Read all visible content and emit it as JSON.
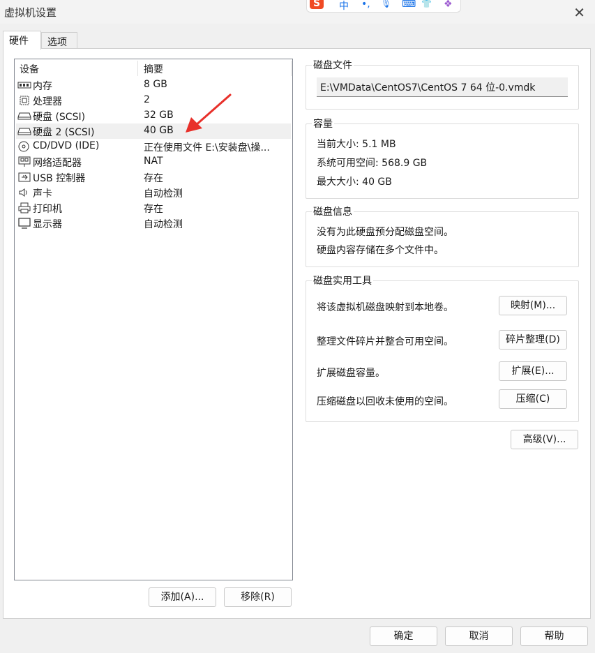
{
  "window": {
    "title": "虚拟机设置",
    "close_glyph": "✕"
  },
  "ime": {
    "logo": "S",
    "lang": "中",
    "punct": "•,",
    "mic": "🎙",
    "keyboard": "⌨",
    "shirt": "👕",
    "apps": "❖"
  },
  "tabs": [
    {
      "label": "硬件",
      "active": true
    },
    {
      "label": "选项",
      "active": false
    }
  ],
  "device_list": {
    "headers": {
      "device": "设备",
      "summary": "摘要"
    },
    "rows": [
      {
        "icon": "memory-icon",
        "name": "内存",
        "summary": "8 GB",
        "selected": false
      },
      {
        "icon": "processor-icon",
        "name": "处理器",
        "summary": "2",
        "selected": false
      },
      {
        "icon": "harddisk-icon",
        "name": "硬盘 (SCSI)",
        "summary": "32 GB",
        "selected": false
      },
      {
        "icon": "harddisk-icon",
        "name": "硬盘 2 (SCSI)",
        "summary": "40 GB",
        "selected": true
      },
      {
        "icon": "cd-dvd-icon",
        "name": "CD/DVD (IDE)",
        "summary": "正在使用文件 E:\\安装盘\\操...",
        "selected": false
      },
      {
        "icon": "network-icon",
        "name": "网络适配器",
        "summary": "NAT",
        "selected": false
      },
      {
        "icon": "usb-icon",
        "name": "USB 控制器",
        "summary": "存在",
        "selected": false
      },
      {
        "icon": "speaker-icon",
        "name": "声卡",
        "summary": "自动检测",
        "selected": false
      },
      {
        "icon": "printer-icon",
        "name": "打印机",
        "summary": "存在",
        "selected": false
      },
      {
        "icon": "monitor-icon",
        "name": "显示器",
        "summary": "自动检测",
        "selected": false
      }
    ]
  },
  "list_buttons": {
    "add": "添加(A)...",
    "remove": "移除(R)"
  },
  "disk_file": {
    "title": "磁盘文件",
    "path": "E:\\VMData\\CentOS7\\CentOS 7 64 位-0.vmdk"
  },
  "capacity": {
    "title": "容量",
    "current_size": "当前大小: 5.1 MB",
    "system_available": "系统可用空间: 568.9 GB",
    "max_size": "最大大小: 40 GB"
  },
  "disk_info": {
    "title": "磁盘信息",
    "line1": "没有为此硬盘预分配磁盘空间。",
    "line2": "硬盘内容存储在多个文件中。"
  },
  "disk_utilities": {
    "title": "磁盘实用工具",
    "map_text": "将该虚拟机磁盘映射到本地卷。",
    "map_button": "映射(M)...",
    "defrag_text": "整理文件碎片并整合可用空间。",
    "defrag_button": "碎片整理(D)",
    "expand_text": "扩展磁盘容量。",
    "expand_button": "扩展(E)...",
    "compact_text": "压缩磁盘以回收未使用的空间。",
    "compact_button": "压缩(C)"
  },
  "advanced_button": "高级(V)...",
  "footer": {
    "ok": "确定",
    "cancel": "取消",
    "help": "帮助"
  },
  "colors": {
    "annotation_arrow": "#e8302a",
    "selected_row": "#f0f0f0",
    "ime_logo": "#f04a24",
    "ime_blue": "#1a73e8"
  }
}
